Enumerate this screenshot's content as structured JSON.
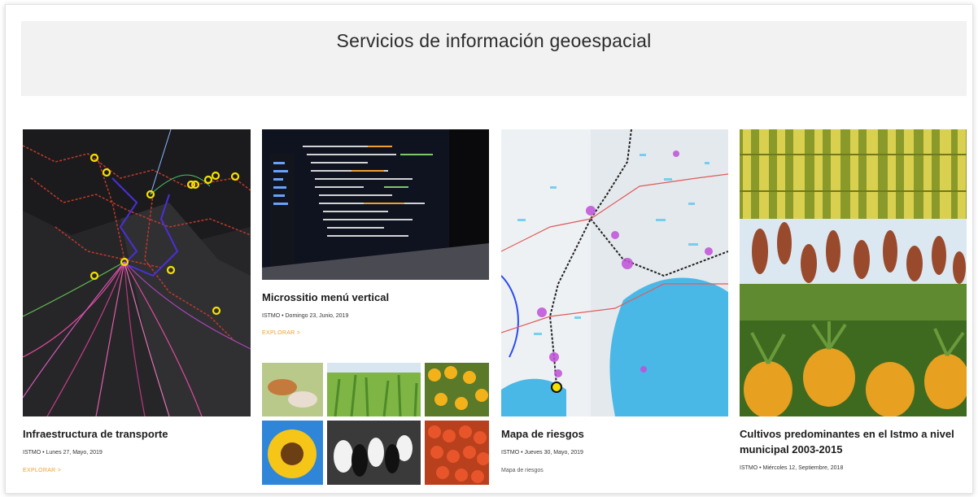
{
  "header": {
    "title": "Servicios de información geoespacial"
  },
  "cards": [
    {
      "title": "Infraestructura de transporte",
      "meta": "ISTMO • Lunes 27, Mayo, 2019",
      "link": "EXPLORAR >"
    },
    {
      "title": "Microssitio menú vertical",
      "meta": "ISTMO • Domingo 23, Junio, 2019",
      "link": "EXPLORAR >"
    },
    {
      "title": "Mapa de riesgos",
      "meta": "ISTMO • Jueves 30, Mayo, 2019",
      "description": "Mapa de riesgos"
    },
    {
      "title": "Cultivos predominantes en el Istmo a nivel municipal 2003-2015",
      "meta": "ISTMO • Miércoles 12, Septiembre, 2018"
    }
  ],
  "colors": {
    "accent": "#f0a030",
    "banner_bg": "#f2f2f2",
    "title": "#1d1d1d"
  },
  "icons": [
    "transport-map-image",
    "code-screen-image",
    "risk-map-image",
    "crops-collage-image"
  ]
}
